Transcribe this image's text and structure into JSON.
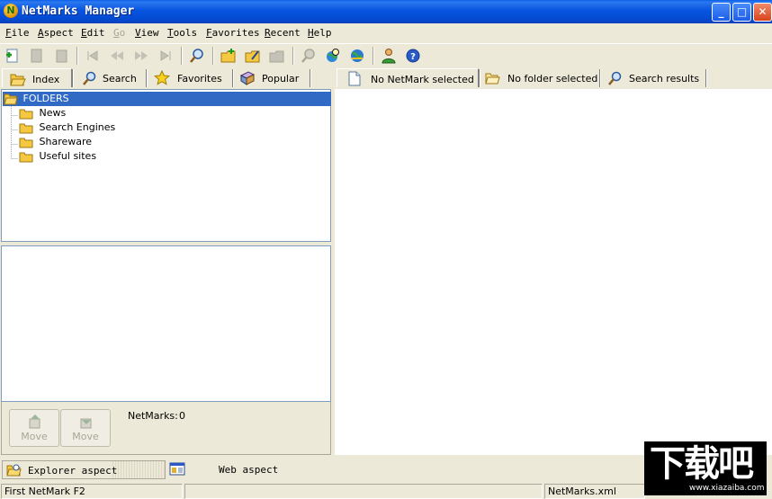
{
  "window": {
    "title": "NetMarks Manager",
    "app_icon_letter": "N"
  },
  "menu": [
    "File",
    "Aspect",
    "Edit",
    "Go",
    "View",
    "Tools",
    "Favorites",
    "Recent",
    "Help"
  ],
  "left_tabs": [
    "Index",
    "Search",
    "Favorites",
    "Popular"
  ],
  "folders": {
    "root": "FOLDERS",
    "items": [
      "News",
      "Search Engines",
      "Shareware",
      "Useful sites"
    ]
  },
  "move_buttons": [
    "Move",
    "Move"
  ],
  "netmarks_count": {
    "label": "NetMarks:",
    "value": "0"
  },
  "right_tabs": [
    "No NetMark selected",
    "No folder selected",
    "Search results"
  ],
  "aspects": {
    "explorer": "Explorer aspect",
    "web": "Web aspect"
  },
  "status": {
    "left": "First NetMark  F2",
    "file": "NetMarks.xml"
  },
  "watermark": {
    "main": "下载吧",
    "url": "www.xiazaiba.com"
  },
  "colors": {
    "title_blue": "#0754e0",
    "selection": "#316ac5",
    "chrome": "#ece9d8",
    "folder": "#f5c842"
  }
}
